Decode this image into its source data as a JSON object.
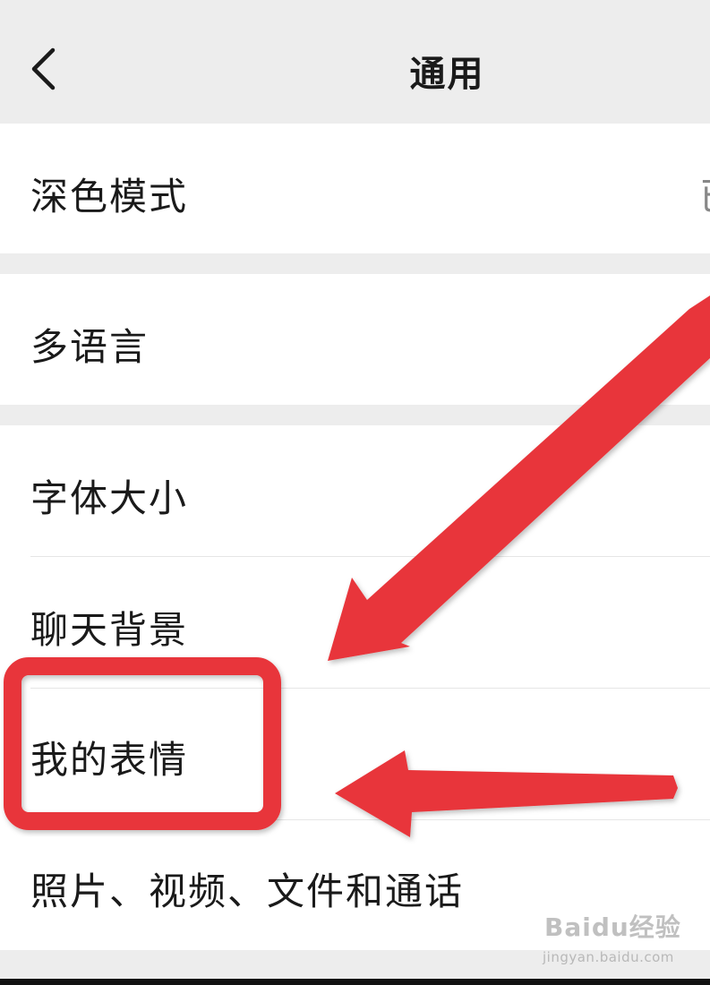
{
  "header": {
    "title": "通用",
    "back_icon": "chevron-left-icon"
  },
  "groups": [
    {
      "items": [
        {
          "label": "深色模式",
          "value": "已"
        }
      ]
    },
    {
      "items": [
        {
          "label": "多语言"
        }
      ]
    },
    {
      "items": [
        {
          "label": "字体大小"
        },
        {
          "label": "聊天背景"
        },
        {
          "label": "我的表情"
        },
        {
          "label": "照片、视频、文件和通话"
        }
      ]
    }
  ],
  "annotations": {
    "highlight_target": "我的表情",
    "highlight_color": "#e8363a",
    "arrow_color": "#e8363a",
    "arrow_count": 2
  },
  "watermark": {
    "logo_text": "Baidu经验",
    "site_text": "jingyan.baidu.com"
  },
  "colors": {
    "background": "#ededed",
    "row_background": "#ffffff",
    "text": "#1a1a1a"
  }
}
